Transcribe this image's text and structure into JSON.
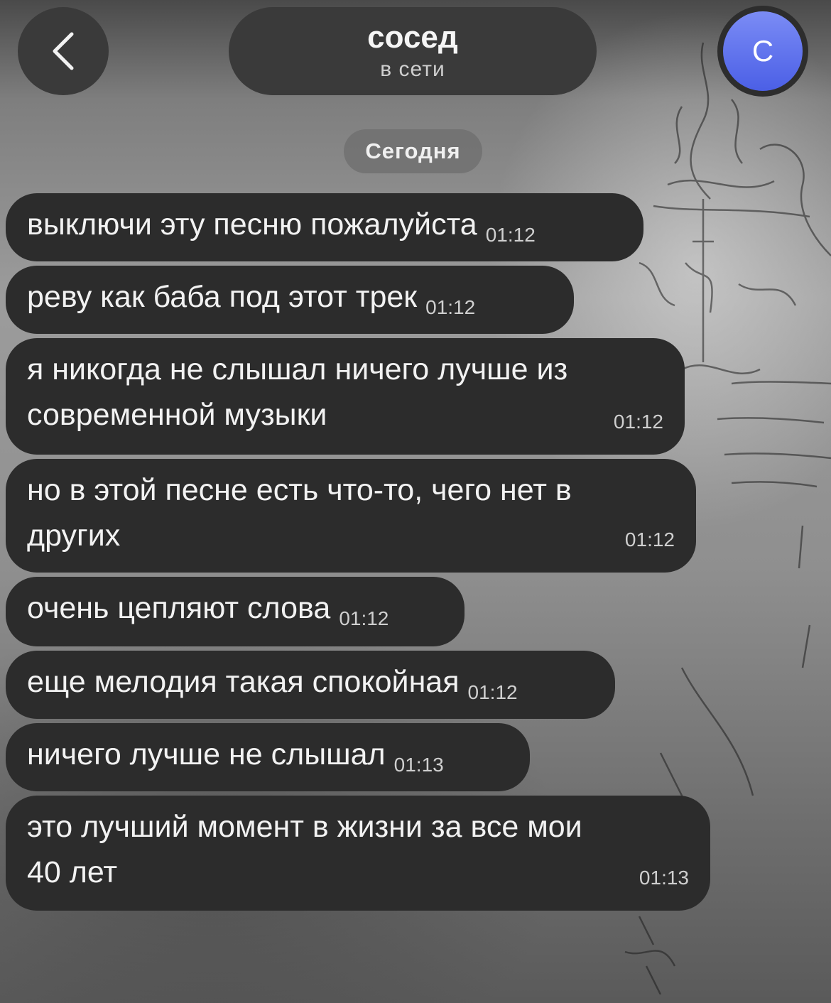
{
  "header": {
    "back_label": "<",
    "contact_name": "сосед",
    "contact_status": "в сети",
    "avatar_letter": "С"
  },
  "chat": {
    "date_label": "Сегодня",
    "messages": [
      {
        "text": "выключи эту песню пожалуйста",
        "time": "01:12"
      },
      {
        "text": "реву как баба под этот трек",
        "time": "01:12"
      },
      {
        "text": "я никогда не слышал ничего лучше из\nсовременной музыки",
        "time": "01:12"
      },
      {
        "text": "но в этой песне есть что-то, чего нет в\nдругих",
        "time": "01:12"
      },
      {
        "text": "очень цепляют слова",
        "time": "01:12"
      },
      {
        "text": "еще мелодия такая спокойная",
        "time": "01:12"
      },
      {
        "text": "ничего лучше не слышал",
        "time": "01:13"
      },
      {
        "text": "это лучший момент в жизни за все мои\n40 лет",
        "time": "01:13"
      }
    ]
  },
  "colors": {
    "bubble": "#2c2c2c",
    "avatar_accent": "#5a6cf0"
  }
}
